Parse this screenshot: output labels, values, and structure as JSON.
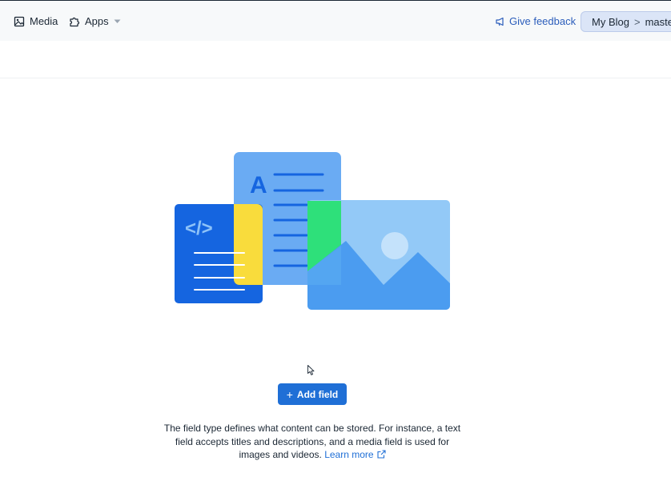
{
  "topbar": {
    "media_label": "Media",
    "apps_label": "Apps",
    "feedback_label": "Give feedback",
    "breadcrumb": {
      "space": "My Blog",
      "separator": ">",
      "environment": "master"
    }
  },
  "empty_state": {
    "add_field_label": "Add field",
    "add_field_icon": "plus-icon",
    "description": "The field type defines what content can be stored. For instance, a text field accepts titles and descriptions, and a media field is used for images and videos.",
    "learn_more_label": "Learn more",
    "illustration_icon_text": "A",
    "code_glyph": "</>"
  },
  "colors": {
    "primary": "#1f6fd6",
    "topbar_bg": "#f7f9fa",
    "illus_blue_dark": "#1565e0",
    "illus_blue_light": "#6aabf3",
    "illus_yellow": "#f9dc3c",
    "illus_green": "#2ee07a"
  }
}
